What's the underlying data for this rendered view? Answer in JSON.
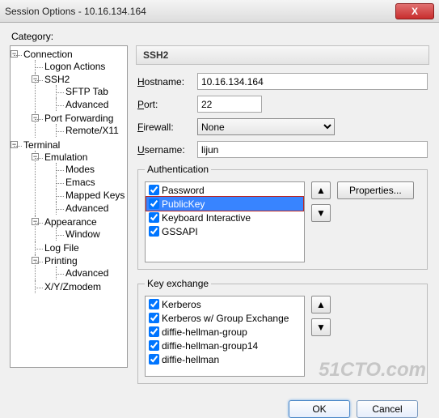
{
  "window": {
    "title": "Session Options - 10.16.134.164",
    "close": "X"
  },
  "category_label": "Category:",
  "tree": {
    "connection": "Connection",
    "logon_actions": "Logon Actions",
    "ssh2": "SSH2",
    "sftp_tab": "SFTP Tab",
    "advanced1": "Advanced",
    "port_forwarding": "Port Forwarding",
    "remote_x11": "Remote/X11",
    "terminal": "Terminal",
    "emulation": "Emulation",
    "modes": "Modes",
    "emacs": "Emacs",
    "mapped_keys": "Mapped Keys",
    "advanced2": "Advanced",
    "appearance": "Appearance",
    "window": "Window",
    "log_file": "Log File",
    "printing": "Printing",
    "advanced3": "Advanced",
    "xyzmodem": "X/Y/Zmodem"
  },
  "panel": {
    "header": "SSH2"
  },
  "form": {
    "hostname_label": "Hostname:",
    "hostname": "10.16.134.164",
    "port_label": "Port:",
    "port": "22",
    "firewall_label": "Firewall:",
    "firewall": "None",
    "username_label": "Username:",
    "username": "lijun"
  },
  "auth": {
    "legend": "Authentication",
    "items": [
      "Password",
      "PublicKey",
      "Keyboard Interactive",
      "GSSAPI"
    ],
    "properties": "Properties..."
  },
  "kex": {
    "legend": "Key exchange",
    "items": [
      "Kerberos",
      "Kerberos w/ Group Exchange",
      "diffie-hellman-group",
      "diffie-hellman-group14",
      "diffie-hellman"
    ]
  },
  "footer": {
    "ok": "OK",
    "cancel": "Cancel"
  },
  "watermark": "51CTO.com"
}
